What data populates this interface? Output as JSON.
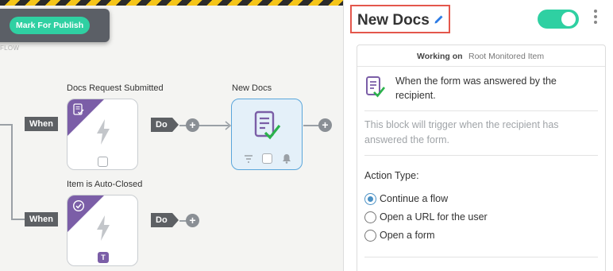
{
  "toolbar": {
    "publish_label": "Mark For Publish",
    "flow_hint": "FLOW"
  },
  "canvas": {
    "when_label": "When",
    "do_label": "Do",
    "plus_label": "+",
    "nodes": [
      {
        "title": "Docs Request Submitted"
      },
      {
        "title": "Item is Auto-Closed",
        "badge": "T"
      },
      {
        "title": "New Docs",
        "selected": true
      }
    ]
  },
  "panel": {
    "title": "New Docs",
    "enabled": true,
    "working_on_label": "Working on",
    "working_on_value": "Root Monitored Item",
    "trigger_text": "When the form was answered by the recipient.",
    "description": "This block will trigger when the recipient has answered the form.",
    "action_type_label": "Action Type:",
    "options": [
      {
        "label": "Continue a flow",
        "selected": true
      },
      {
        "label": "Open a URL for the user",
        "selected": false
      },
      {
        "label": "Open a form",
        "selected": false
      }
    ]
  },
  "colors": {
    "accent": "#2fd0a2",
    "purple": "#7b5ea7",
    "highlight": "#e4574c",
    "radio": "#4a90c4"
  },
  "icons": [
    "pencil-icon",
    "kebab-menu-icon",
    "document-check-icon",
    "lightning-bolt-icon",
    "filter-icon",
    "bell-icon"
  ]
}
